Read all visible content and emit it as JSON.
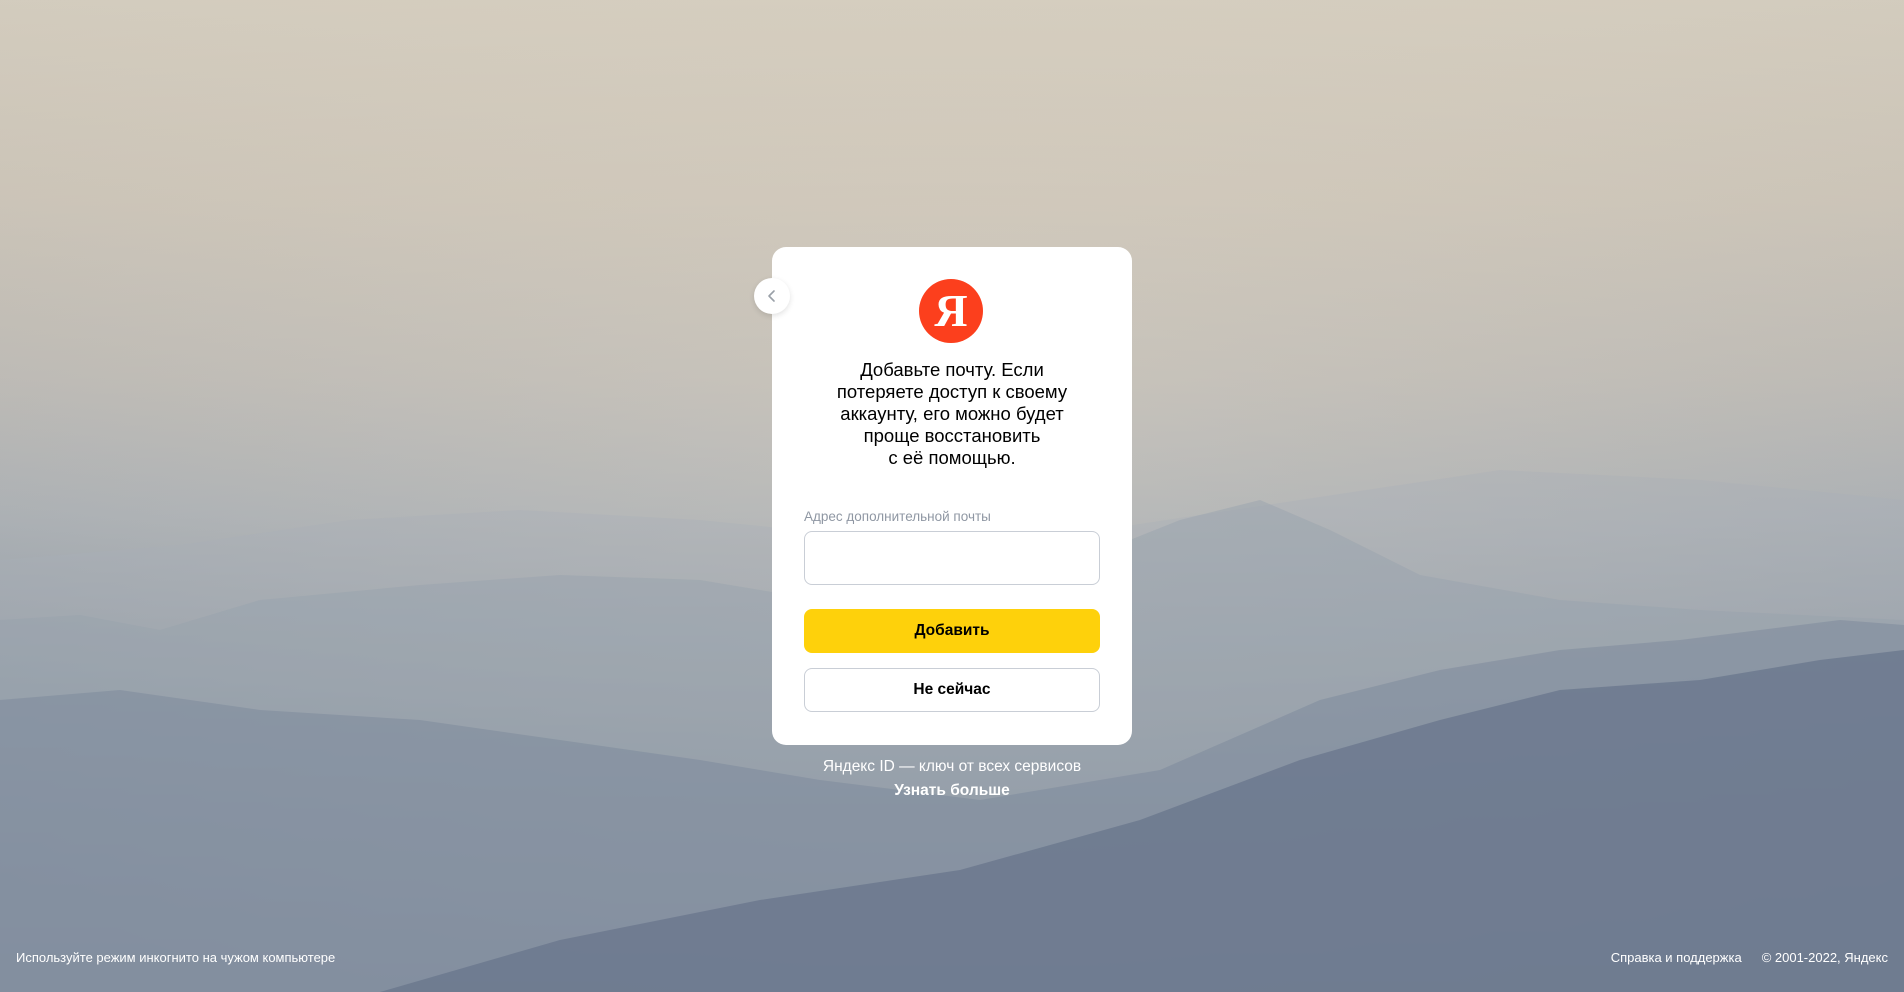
{
  "card": {
    "logo_letter": "Я",
    "headline": "Добавьте почту. Если\nпотеряете доступ к своему\nаккаунту, его можно будет\nпроще восстановить\nс её помощью.",
    "email_label": "Адрес дополнительной почты",
    "email_value": "",
    "add_button": "Добавить",
    "skip_button": "Не сейчас"
  },
  "promo": {
    "text": "Яндекс ID — ключ от всех сервисов",
    "link": "Узнать больше"
  },
  "footer": {
    "left_text": "Используйте режим инкогнито на чужом компьютере",
    "help_link": "Справка и поддержка",
    "copyright": "© 2001-2022, Яндекс"
  },
  "colors": {
    "brand_red": "#fc3f1d",
    "primary_yellow": "#fed10b"
  },
  "icons": {
    "back": "chevron-left-icon",
    "logo": "yandex-logo-icon"
  }
}
